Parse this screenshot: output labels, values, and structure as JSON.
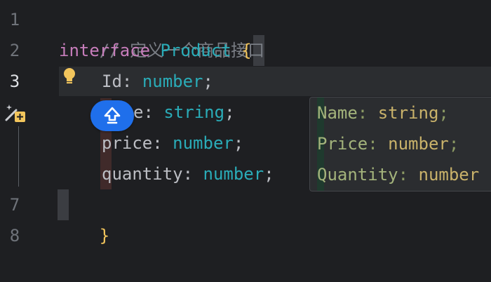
{
  "gutter": {
    "line_numbers": [
      "1",
      "2",
      "3",
      "7",
      "8"
    ],
    "icons": {
      "wand": "ai-generate-icon",
      "bulb": "lightbulb-icon"
    }
  },
  "code": {
    "line1": {
      "comment": "// 定义一个商品接口"
    },
    "line2": {
      "keyword": "interface",
      "name": "Product",
      "brace": "{"
    },
    "line3": {
      "prop": "Id",
      "colon": ": ",
      "type": "number",
      "semi": ";"
    },
    "line4": {
      "prop": "e",
      "colon": ": ",
      "type": "string",
      "semi": ";"
    },
    "line5": {
      "prop": "price",
      "colon": ": ",
      "type": "number",
      "semi": ";"
    },
    "line6": {
      "prop": "quantity",
      "colon": ": ",
      "type": "number",
      "semi": ";"
    },
    "line7": {
      "brace": "}"
    }
  },
  "suggestion": {
    "lines": [
      {
        "prop": "Name",
        "colon": ": ",
        "type": "string",
        "semi": ";"
      },
      {
        "prop": "Price",
        "colon": ": ",
        "type": "number",
        "semi": ";"
      },
      {
        "prop": "Quantity",
        "colon": ": ",
        "type": "number",
        "semi": ""
      }
    ]
  },
  "colors": {
    "background": "#1e1f22",
    "keyword": "#c77dbb",
    "type": "#56a8f5",
    "brace": "#f2c55c",
    "accent_blue": "#1f6feb"
  }
}
